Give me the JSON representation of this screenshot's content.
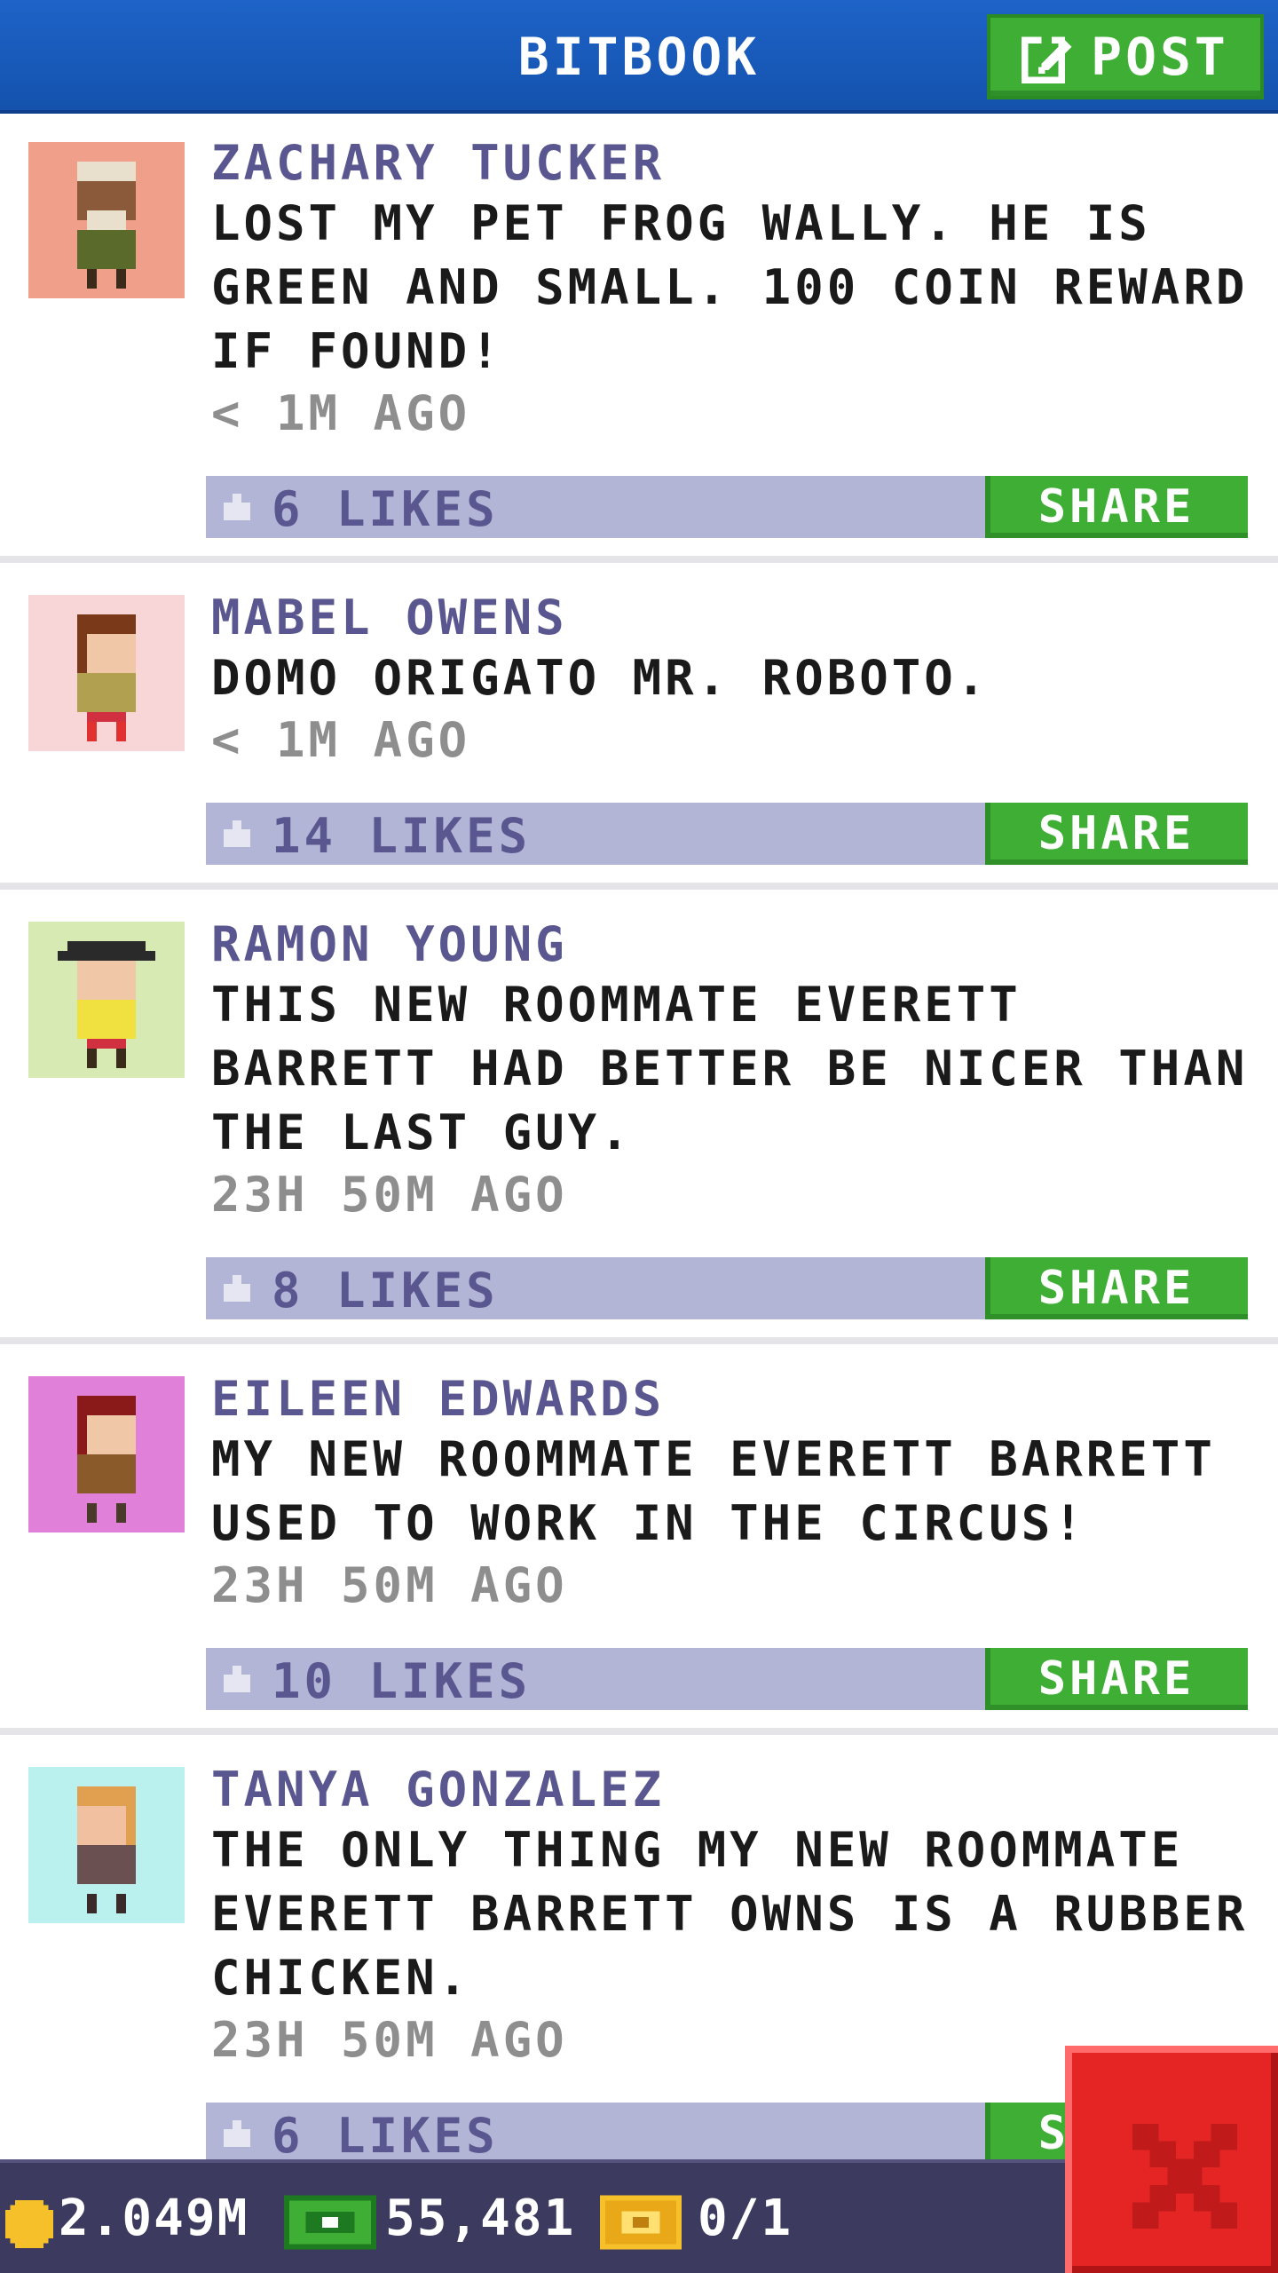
{
  "header": {
    "title": "BITBOOK",
    "post_label": "POST"
  },
  "posts": [
    {
      "author": "ZACHARY TUCKER",
      "text": "LOST MY PET FROG WALLY. HE IS GREEN AND SMALL. 100 COIN REWARD IF FOUND!",
      "time": "< 1M AGO",
      "likes": "6 LIKES",
      "share_label": "SHARE",
      "avatar_bg": "#f0a08a"
    },
    {
      "author": "MABEL OWENS",
      "text": "DOMO ORIGATO MR. ROBOTO.",
      "time": "< 1M AGO",
      "likes": "14 LIKES",
      "share_label": "SHARE",
      "avatar_bg": "#f8d6d8"
    },
    {
      "author": "RAMON YOUNG",
      "text": "THIS NEW ROOMMATE EVERETT BARRETT HAD BETTER BE NICER THAN THE LAST GUY.",
      "time": "23H 50M AGO",
      "likes": "8 LIKES",
      "share_label": "SHARE",
      "avatar_bg": "#d8eab4"
    },
    {
      "author": "EILEEN EDWARDS",
      "text": "MY NEW ROOMMATE EVERETT BARRETT USED TO WORK IN THE CIRCUS!",
      "time": "23H 50M AGO",
      "likes": "10 LIKES",
      "share_label": "SHARE",
      "avatar_bg": "#e080d8"
    },
    {
      "author": "TANYA GONZALEZ",
      "text": "THE ONLY THING MY NEW ROOMMATE EVERETT BARRETT OWNS IS A RUBBER CHICKEN.",
      "time": "23H 50M AGO",
      "likes": "6 LIKES",
      "share_label": "SHARE",
      "avatar_bg": "#baf0ee"
    }
  ],
  "status": {
    "coins": "2.049M",
    "bux": "55,481",
    "vip": "0/1"
  },
  "colors": {
    "header": "#1a5cbf",
    "green": "#3fae35",
    "likebar": "#b3b5d6",
    "author": "#5a5790",
    "close": "#e52424"
  },
  "icons": {
    "post": "edit-icon",
    "like": "thumb-up-icon",
    "coin": "coin-icon",
    "bux": "bux-icon",
    "vip": "vip-ticket-icon",
    "close": "close-icon"
  }
}
